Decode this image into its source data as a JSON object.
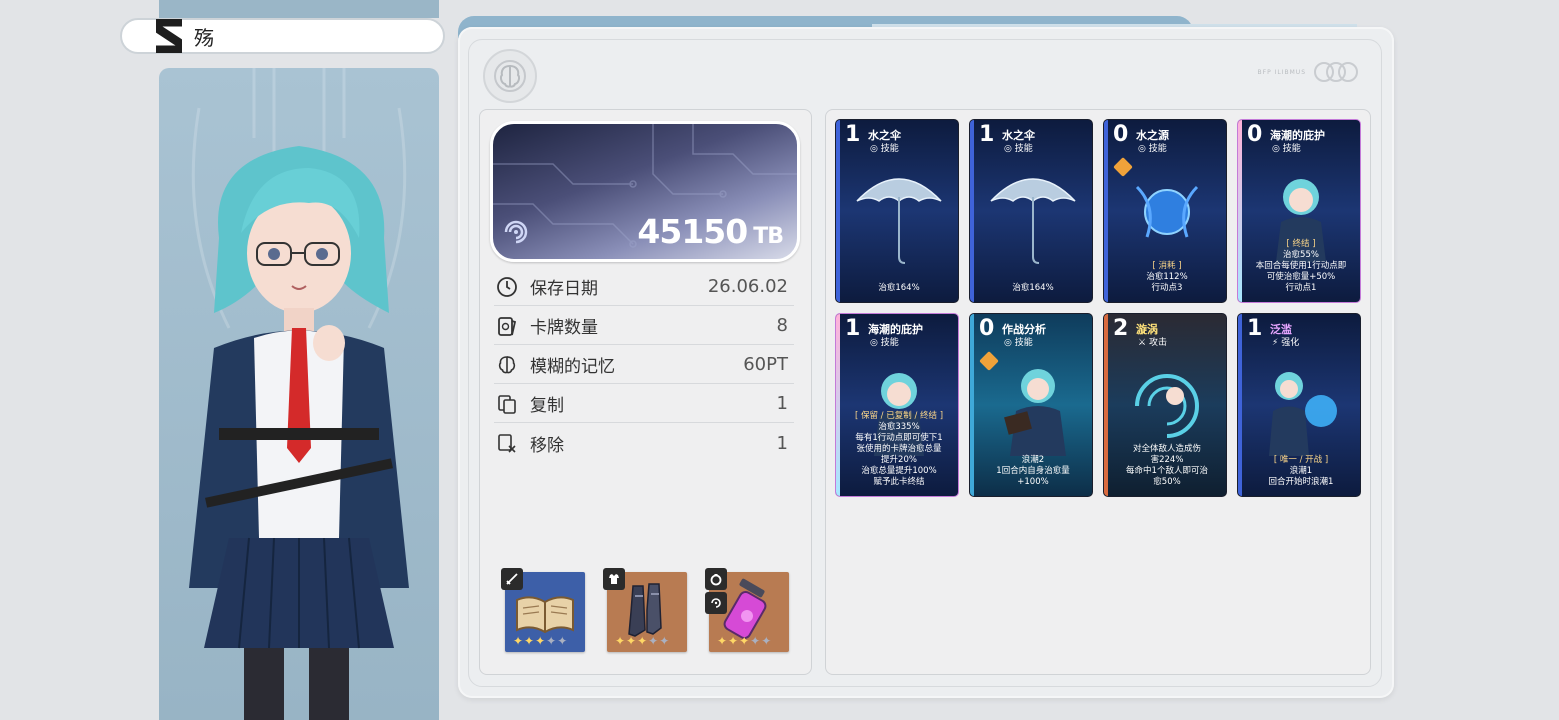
{
  "character": {
    "name": "殇"
  },
  "balance": {
    "amount": "45150",
    "unit": "TB"
  },
  "stats": [
    {
      "label": "保存日期",
      "value": "26.06.02",
      "icon": "clock-icon"
    },
    {
      "label": "卡牌数量",
      "value": "8",
      "icon": "cards-icon"
    },
    {
      "label": "模糊的记忆",
      "value": "60PT",
      "icon": "brain-icon"
    },
    {
      "label": "复制",
      "value": "1",
      "icon": "copy-icon"
    },
    {
      "label": "移除",
      "value": "1",
      "icon": "remove-icon"
    }
  ],
  "equipment": [
    {
      "slot": "sword-icon",
      "item": "book",
      "stars_lit": 3,
      "stars_total": 5,
      "bg": "#3d5fa8"
    },
    {
      "slot": "armor-icon",
      "item": "boots",
      "stars_lit": 3,
      "stars_total": 5,
      "bg": "#b87b52"
    },
    {
      "slot": "ring-icon",
      "item": "vial",
      "stars_lit": 3,
      "stars_total": 5,
      "bg": "#b87b52"
    }
  ],
  "cards": [
    {
      "cost": "1",
      "name": "水之伞",
      "type": "技能",
      "desc": [
        "治愈164%"
      ]
    },
    {
      "cost": "1",
      "name": "水之伞",
      "type": "技能",
      "desc": [
        "治愈164%"
      ]
    },
    {
      "cost": "0",
      "name": "水之源",
      "type": "技能",
      "desc": [
        "[ 消耗 ]",
        "治愈112%",
        "行动点3"
      ]
    },
    {
      "cost": "0",
      "name": "海潮的庇护",
      "type": "技能",
      "desc": [
        "[ 终结 ]",
        "治愈55%",
        "本回合每使用1行动点即",
        "可使治愈量+50%",
        "行动点1"
      ]
    },
    {
      "cost": "1",
      "name": "海潮的庇护",
      "type": "技能",
      "desc": [
        "[ 保留 / 已复制 / 终结 ]",
        "治愈335%",
        "每有1行动点即可使下1",
        "张使用的卡牌治愈总量",
        "提升20%",
        "治愈总量提升100%",
        "赋予此卡终结"
      ]
    },
    {
      "cost": "0",
      "name": "作战分析",
      "type": "技能",
      "desc": [
        "浪潮2",
        "1回合内自身治愈量",
        "+100%"
      ]
    },
    {
      "cost": "2",
      "name": "漩涡",
      "type": "攻击",
      "desc": [
        "对全体敌人造成伤",
        "害224%",
        "每命中1个敌人即可治",
        "愈50%"
      ]
    },
    {
      "cost": "1",
      "name": "泛滥",
      "type": "强化",
      "desc": [
        "[ 唯一 / 开战 ]",
        "浪潮1",
        "回合开始时浪潮1"
      ]
    }
  ],
  "logo_text": "BFP ILIBMUS"
}
